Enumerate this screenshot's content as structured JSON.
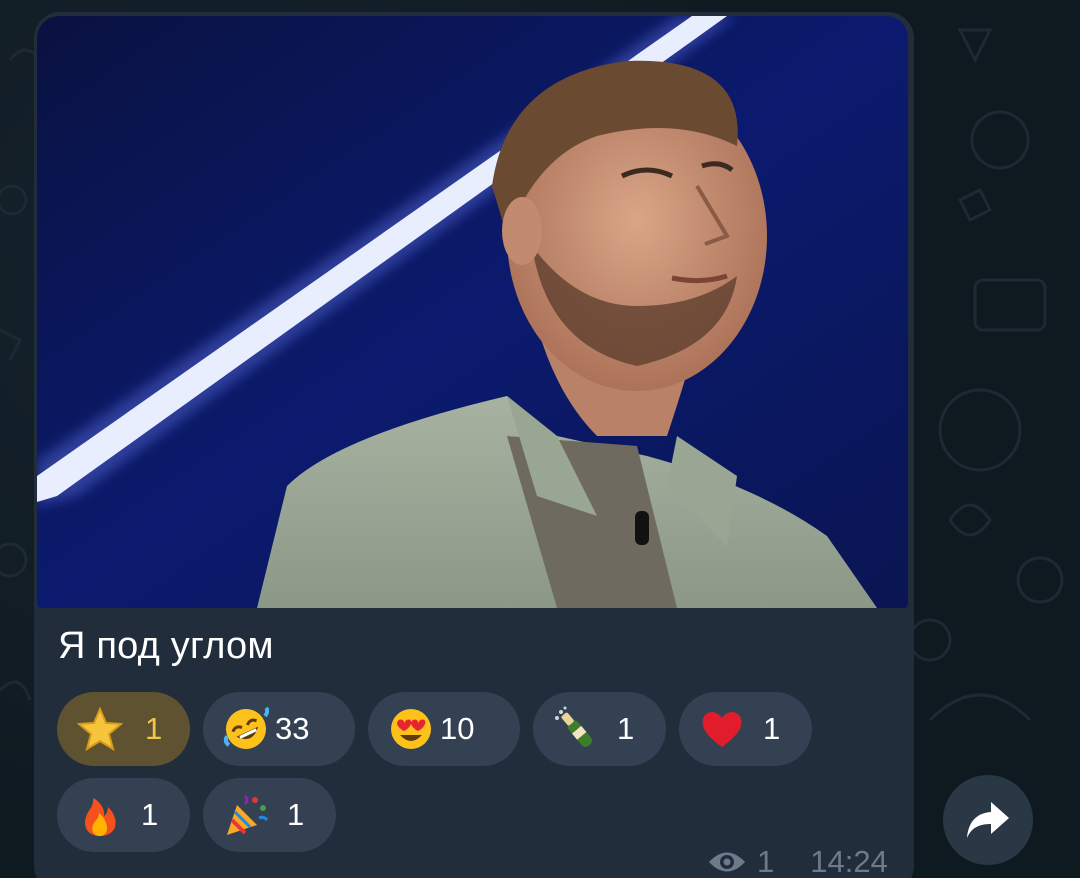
{
  "message": {
    "caption": "Я под углом",
    "reactions": [
      {
        "emoji_name": "star-icon",
        "count": "1",
        "chosen": true
      },
      {
        "emoji_name": "rofl-emoji-icon",
        "count": "33",
        "chosen": false
      },
      {
        "emoji_name": "heart-eyes-emoji-icon",
        "count": "10",
        "chosen": false
      },
      {
        "emoji_name": "champagne-bottle-icon",
        "count": "1",
        "chosen": false
      },
      {
        "emoji_name": "red-heart-icon",
        "count": "1",
        "chosen": false
      },
      {
        "emoji_name": "fire-icon",
        "count": "1",
        "chosen": false
      },
      {
        "emoji_name": "party-popper-icon",
        "count": "1",
        "chosen": false
      }
    ],
    "views": "1",
    "time": "14:24"
  },
  "colors": {
    "bubble": "#212d3b",
    "reaction_bg": "#334153",
    "chosen_reaction_bg": "#5e5230",
    "chosen_reaction_text": "#f0c64b",
    "meta_text": "#6b7b8c"
  }
}
